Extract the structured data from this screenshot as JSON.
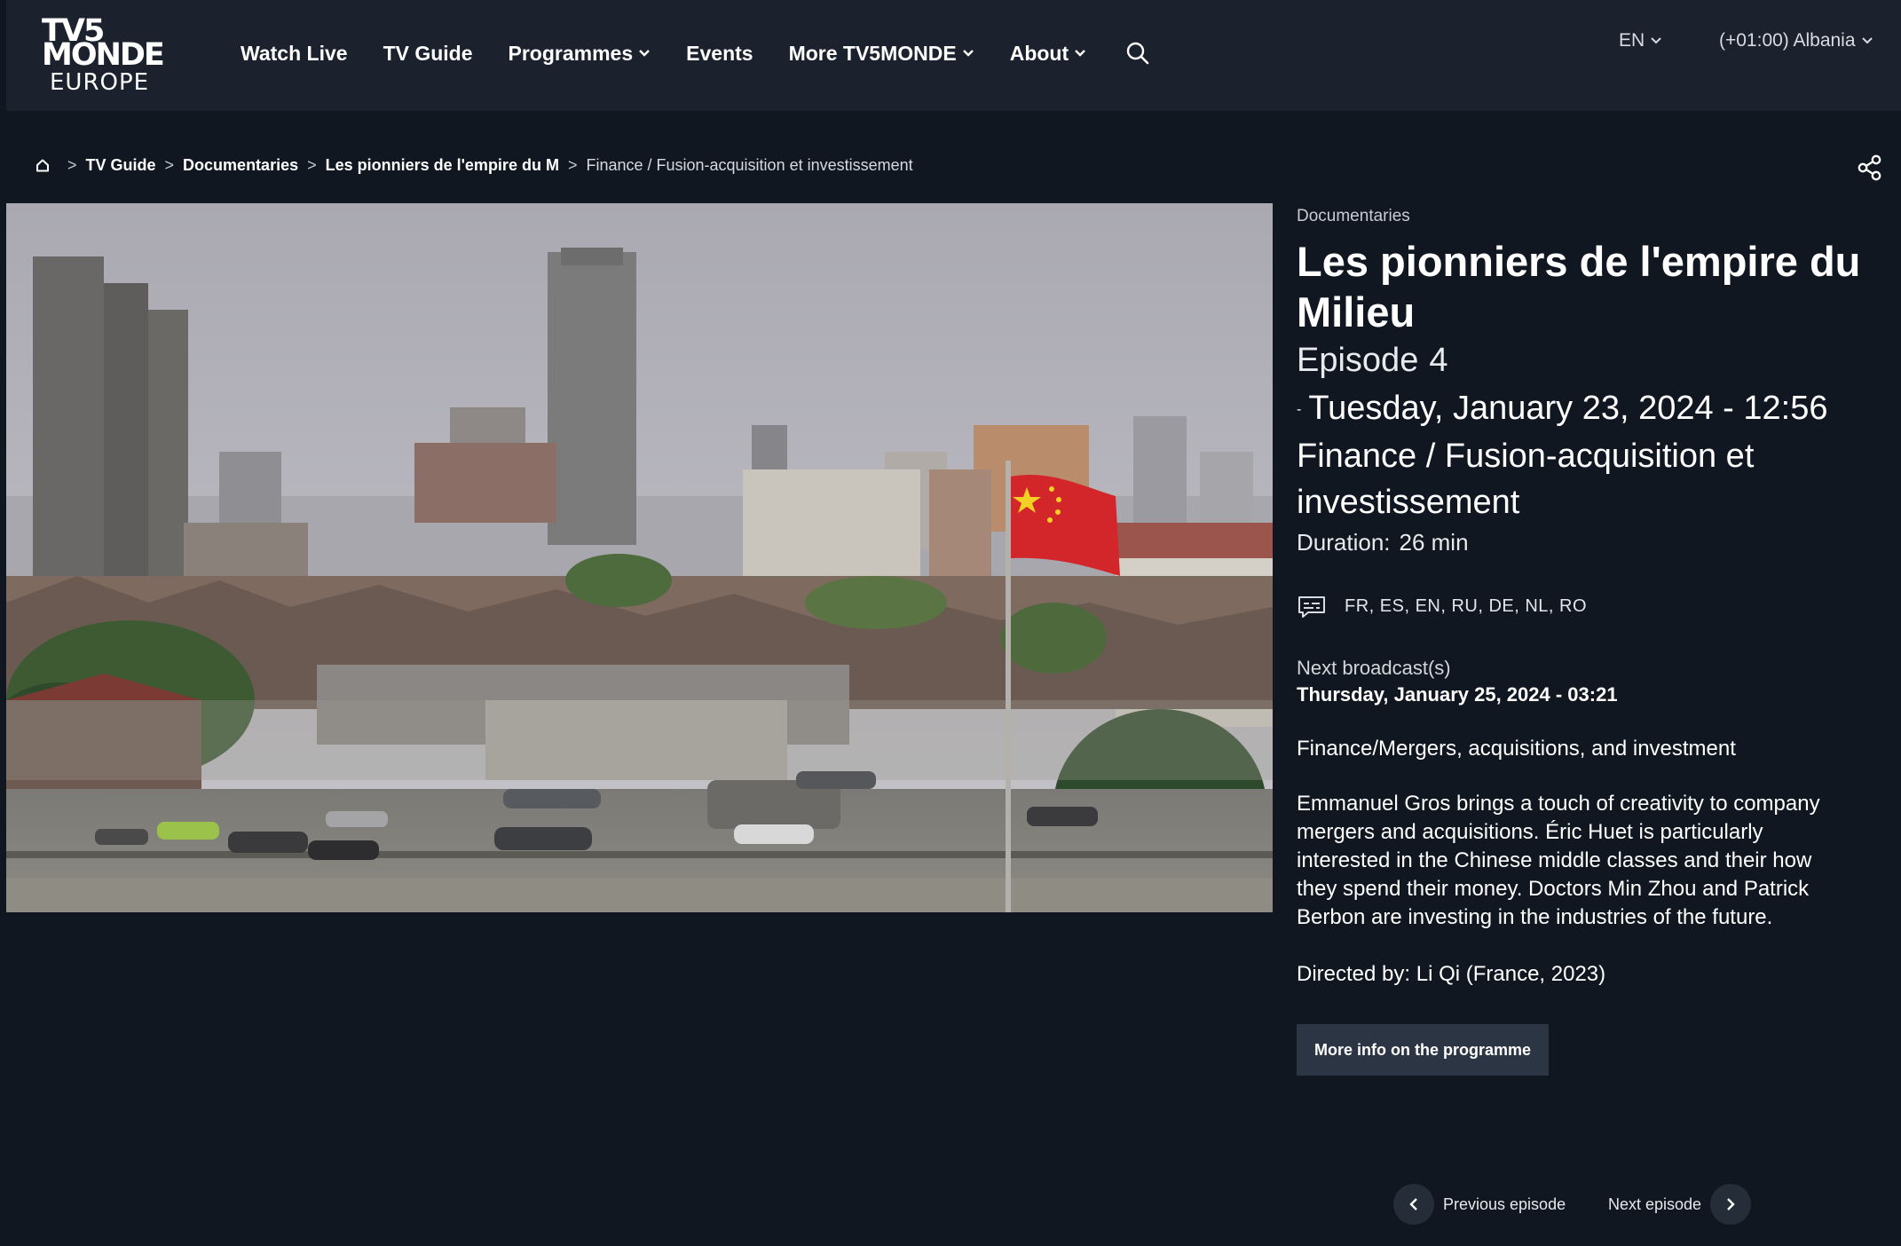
{
  "header": {
    "logo": {
      "line1": "TV5",
      "line2": "MONDE",
      "line3": "EUROPE"
    },
    "nav": [
      {
        "label": "Watch Live",
        "dropdown": false
      },
      {
        "label": "TV Guide",
        "dropdown": false
      },
      {
        "label": "Programmes",
        "dropdown": true
      },
      {
        "label": "Events",
        "dropdown": false
      },
      {
        "label": "More TV5MONDE",
        "dropdown": true
      },
      {
        "label": "About",
        "dropdown": true
      }
    ],
    "language": "EN",
    "timezone": "(+01:00) Albania"
  },
  "breadcrumb": {
    "items": [
      "TV Guide",
      "Documentaries",
      "Les pionniers de l'empire du M"
    ],
    "current": "Finance / Fusion-acquisition et investissement",
    "separator": ">"
  },
  "programme": {
    "category": "Documentaries",
    "title": "Les pionniers de l'empire du Milieu",
    "episode_label": "Episode",
    "episode_number": "4",
    "airdate_dash": "-",
    "airdate": "Tuesday, January 23, 2024 - 12:56",
    "episode_title": "Finance / Fusion-acquisition et investissement",
    "duration_label": "Duration:",
    "duration_value": "26 min",
    "subtitles": "FR, ES, EN, RU, DE, NL, RO",
    "next_broadcast_label": "Next broadcast(s)",
    "next_broadcast_date": "Thursday, January 25, 2024 - 03:21",
    "genre_line": "Finance/Mergers, acquisitions, and investment",
    "synopsis": "Emmanuel Gros brings a touch of creativity to company mergers and acquisitions. Éric Huet is particularly interested in the Chinese middle classes and their how they spend their money. Doctors Min Zhou and Patrick Berbon are investing in the industries of the future.",
    "director": "Directed by: Li Qi (France, 2023)",
    "more_info_button": "More info on the programme"
  },
  "episode_nav": {
    "previous": "Previous episode",
    "next": "Next episode"
  },
  "icons": {
    "home": "home-icon",
    "search": "search-icon",
    "share": "share-icon",
    "subtitles": "subtitles-icon",
    "chevron_down": "chevron-down-icon",
    "chevron_left": "chevron-left-icon",
    "chevron_right": "chevron-right-icon"
  },
  "colors": {
    "background": "#101720",
    "header": "#1b222d",
    "button": "#2c3543",
    "flag": "#d3262a"
  }
}
